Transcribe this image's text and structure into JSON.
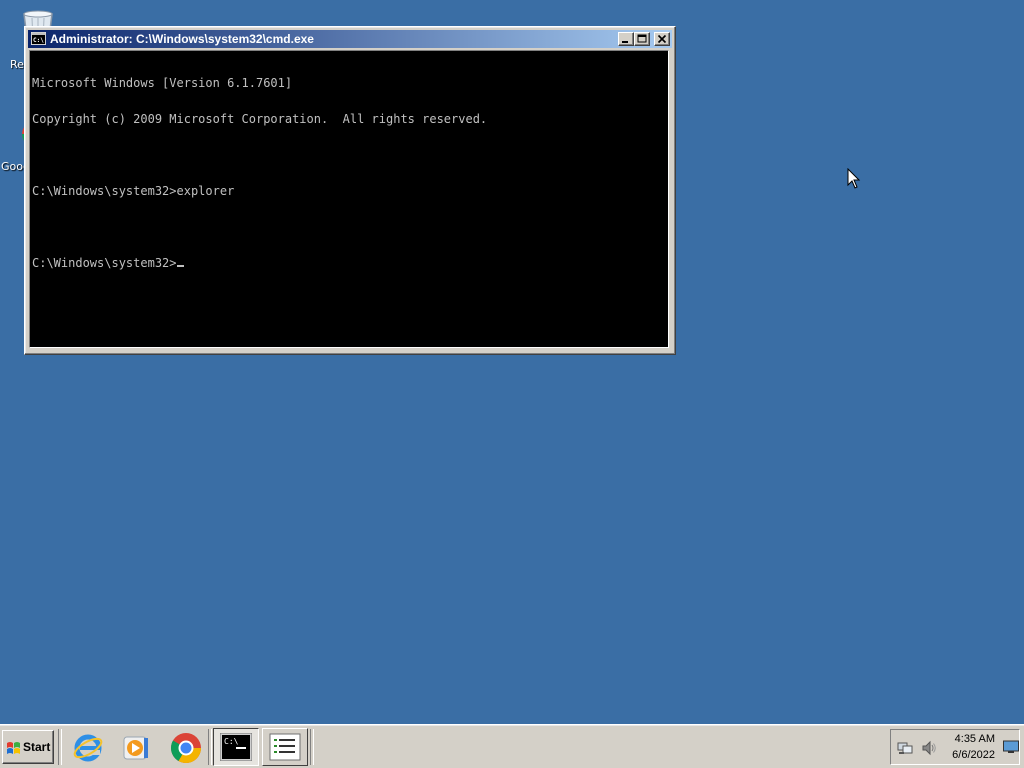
{
  "desktop": {
    "background": "#3a6ea5",
    "icons": [
      {
        "label": "Re",
        "icon": "recycle-bin-icon"
      },
      {
        "label": "Goog",
        "icon": "google-chrome-shortcut-icon"
      }
    ]
  },
  "cmd_window": {
    "title": "Administrator: C:\\Windows\\system32\\cmd.exe",
    "buttons": {
      "minimize": "_",
      "maximize": "□",
      "close": "✕"
    },
    "console_lines": [
      "Microsoft Windows [Version 6.1.7601]",
      "Copyright (c) 2009 Microsoft Corporation.  All rights reserved.",
      "",
      "C:\\Windows\\system32>explorer",
      "",
      "C:\\Windows\\system32>"
    ]
  },
  "taskbar": {
    "start_label": "Start",
    "quick_launch": [
      "internet-explorer-icon",
      "windows-media-player-icon",
      "chrome-icon"
    ],
    "tasks": [
      {
        "name": "cmd-task",
        "icon": "command-prompt-icon",
        "active": true
      },
      {
        "name": "notepad-task",
        "icon": "list-document-icon",
        "active": false
      }
    ],
    "tray": {
      "time": "4:35 AM",
      "date": "6/6/2022",
      "icons": [
        "network-icon",
        "volume-icon",
        "show-desktop-icon"
      ]
    }
  }
}
